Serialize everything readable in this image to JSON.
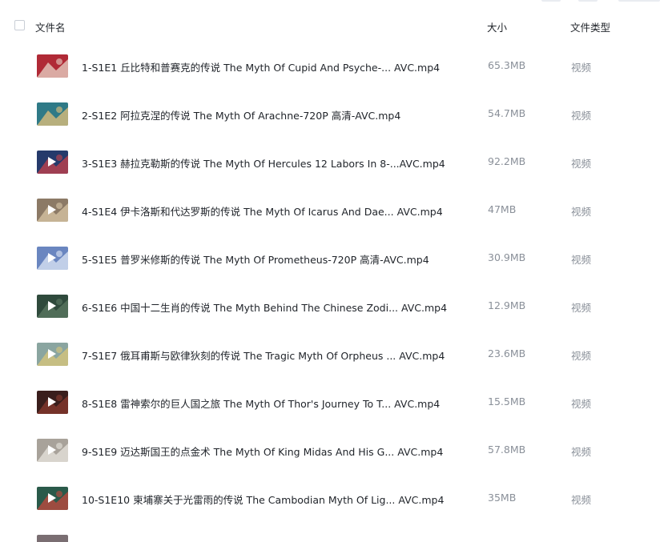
{
  "header": {
    "name_label": "文件名",
    "size_label": "大小",
    "type_label": "文件类型"
  },
  "files": [
    {
      "name": "1-S1E1 丘比特和普赛克的传说 The Myth Of Cupid And Psyche-...  AVC.mp4",
      "size": "65.3MB",
      "type": "视频",
      "thumb_color": "#b02a36",
      "thumb_color2": "#e8d5c8",
      "play": false
    },
    {
      "name": "2-S1E2 阿拉克涅的传说 The Myth Of Arachne-720P 高清-AVC.mp4",
      "size": "54.7MB",
      "type": "视频",
      "thumb_color": "#2f7a87",
      "thumb_color2": "#e6c27a",
      "play": false
    },
    {
      "name": "3-S1E3 赫拉克勒斯的传说 The Myth Of Hercules 12 Labors In 8-...AVC.mp4",
      "size": "92.2MB",
      "type": "视频",
      "thumb_color": "#263a6b",
      "thumb_color2": "#c8424a",
      "play": true
    },
    {
      "name": "4-S1E4 伊卡洛斯和代达罗斯的传说 The Myth Of Icarus And Dae... AVC.mp4",
      "size": "47MB",
      "type": "视频",
      "thumb_color": "#8c7a66",
      "thumb_color2": "#d9c7a6",
      "play": true
    },
    {
      "name": "5-S1E5 普罗米修斯的传说 The Myth Of Prometheus-720P 高清-AVC.mp4",
      "size": "30.9MB",
      "type": "视频",
      "thumb_color": "#6a86c0",
      "thumb_color2": "#dfe7f5",
      "play": true
    },
    {
      "name": "6-S1E6 中国十二生肖的传说 The Myth Behind The Chinese Zodi... AVC.mp4",
      "size": "12.9MB",
      "type": "视频",
      "thumb_color": "#2f4a3c",
      "thumb_color2": "#5c7a62",
      "play": true
    },
    {
      "name": "7-S1E7 俄耳甫斯与欧律狄刻的传说 The Tragic Myth Of Orpheus ... AVC.mp4",
      "size": "23.6MB",
      "type": "视频",
      "thumb_color": "#8aa5a0",
      "thumb_color2": "#d9c77a",
      "play": true
    },
    {
      "name": "8-S1E8 雷神索尔的巨人国之旅 The Myth Of Thor's Journey To T... AVC.mp4",
      "size": "15.5MB",
      "type": "视频",
      "thumb_color": "#3a1e1c",
      "thumb_color2": "#8a3a2e",
      "play": true
    },
    {
      "name": "9-S1E9 迈达斯国王的点金术 The Myth Of King Midas And His G... AVC.mp4",
      "size": "57.8MB",
      "type": "视频",
      "thumb_color": "#a8a29a",
      "thumb_color2": "#e8e4de",
      "play": true
    },
    {
      "name": "10-S1E10 柬埔寨关于光雷雨的传说 The Cambodian Myth Of Lig... AVC.mp4",
      "size": "35MB",
      "type": "视频",
      "thumb_color": "#2a5a4a",
      "thumb_color2": "#c4483e",
      "play": true
    }
  ]
}
